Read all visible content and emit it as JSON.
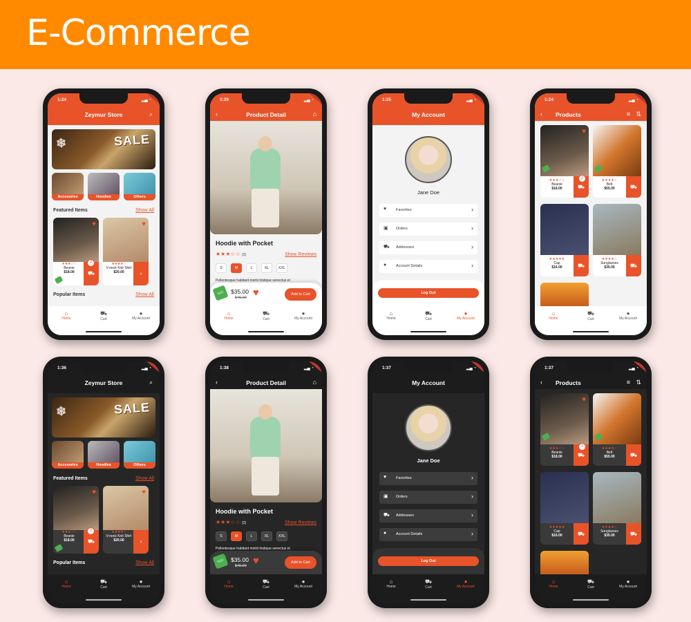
{
  "banner": {
    "title": "E-Commerce"
  },
  "colors": {
    "accent": "#e8532a",
    "banner": "#ff8a00",
    "background": "#fbe9e7",
    "tag_green": "#4caf50"
  },
  "home": {
    "time_light": "1:24",
    "time_dark": "1:36",
    "title": "Zeymur Store",
    "search_icon": "search-icon",
    "sale_text": "SALE",
    "categories": [
      {
        "label": "Accesories"
      },
      {
        "label": "Hoodies"
      },
      {
        "label": "Others"
      }
    ],
    "featured_title": "Featured Items",
    "popular_title": "Popular Items",
    "show_all": "Show All",
    "featured": [
      {
        "name": "Beanie",
        "price": "$18.00",
        "stars": "★★★☆☆",
        "cart_count": "2"
      },
      {
        "name": "V-neck Knit Shirt",
        "price": "$20.00",
        "stars": "★★★★☆"
      }
    ]
  },
  "detail": {
    "time_light": "1:29",
    "time_dark": "1:38",
    "title": "Product Detail",
    "product_name": "Hoodie with Pocket",
    "stars": "★★★☆☆",
    "rating_count": "(2)",
    "show_reviews": "Show Reviews",
    "sizes": [
      {
        "label": "S"
      },
      {
        "label": "M"
      },
      {
        "label": "L"
      },
      {
        "label": "XL"
      },
      {
        "label": "XXL"
      }
    ],
    "selected_size": "M",
    "description": "Pellentesque habitant morbi tristique senectus et",
    "discount": "%22",
    "price": "$35.00",
    "old_price": "$45.00",
    "add_to_cart": "Add to Cart"
  },
  "account": {
    "time_light": "1:25",
    "time_dark": "1:37",
    "title": "My Account",
    "user_name": "Jane Doe",
    "items": [
      {
        "label": "Favorites",
        "icon": "heart-icon"
      },
      {
        "label": "Orders",
        "icon": "bag-icon"
      },
      {
        "label": "Addresses",
        "icon": "truck-icon"
      },
      {
        "label": "Account Details",
        "icon": "person-icon"
      }
    ],
    "logout": "Log Out"
  },
  "products": {
    "time_dark": "1:37",
    "title": "Products",
    "items": [
      {
        "name": "Beanie",
        "price": "$18.00",
        "stars": "★★★☆☆",
        "cart_count": "2"
      },
      {
        "name": "Belt",
        "price": "$55.00",
        "stars": "★★★★☆"
      },
      {
        "name": "Cap",
        "price": "$16.00",
        "stars": "★★★★★"
      },
      {
        "name": "Sunglasses",
        "price": "$35.00",
        "stars": "★★★★☆"
      }
    ]
  },
  "bottom_nav": [
    {
      "label": "Home"
    },
    {
      "label": "Cart"
    },
    {
      "label": "My Account"
    }
  ]
}
